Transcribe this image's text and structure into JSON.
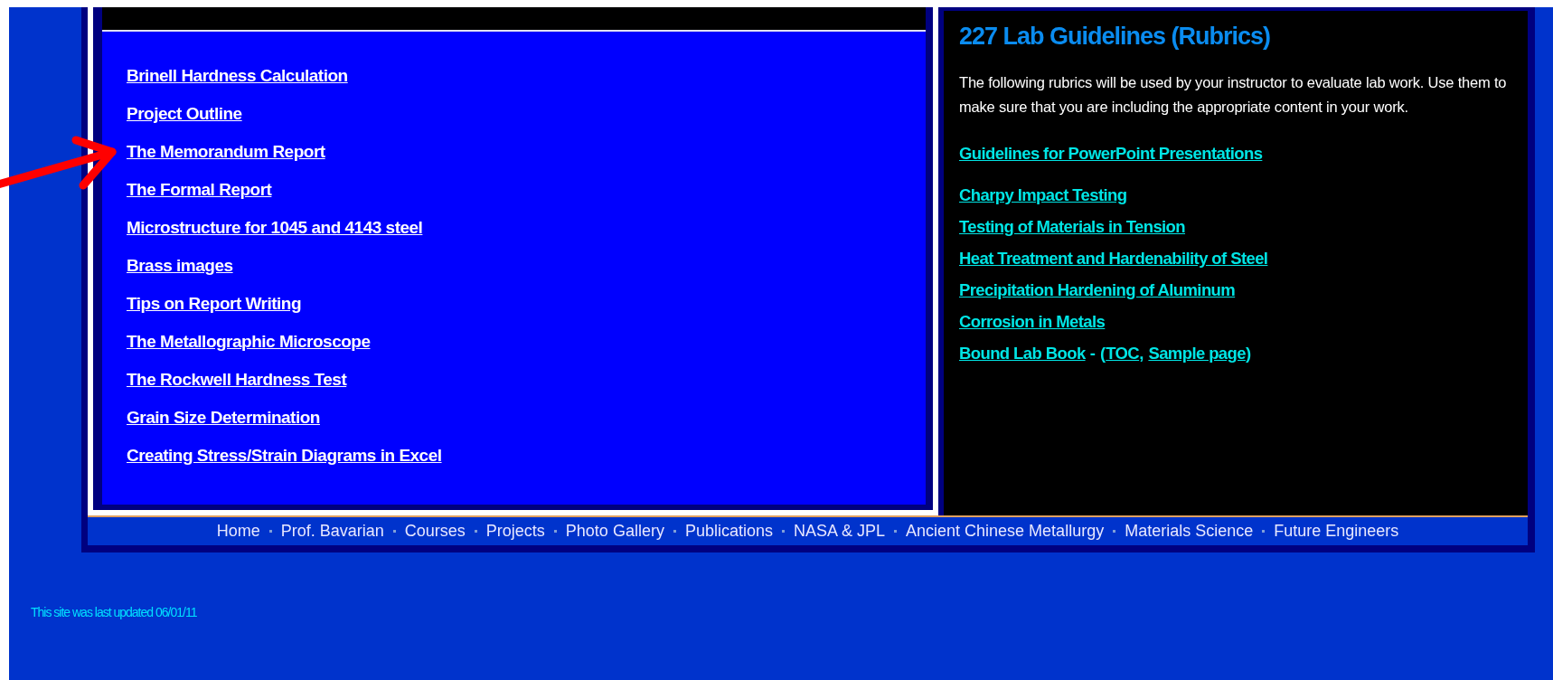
{
  "left_panel": {
    "links": [
      {
        "label": "Brinell Hardness Calculation"
      },
      {
        "label": "Project Outline"
      },
      {
        "label": "The Memorandum Report"
      },
      {
        "label": "The Formal Report"
      },
      {
        "label": "Microstructure for 1045 and 4143 steel"
      },
      {
        "label": "Brass images"
      },
      {
        "label": "Tips on Report Writing"
      },
      {
        "label": "The Metallographic Microscope"
      },
      {
        "label": "The Rockwell Hardness Test"
      },
      {
        "label": "Grain Size Determination"
      },
      {
        "label": "Creating Stress/Strain Diagrams in Excel"
      }
    ]
  },
  "right_panel": {
    "title": "227 Lab Guidelines (Rubrics)",
    "intro": "The following rubrics will be used by your instructor to evaluate lab work. Use them to make sure that you are including the appropriate content in your work.",
    "featured_link": "Guidelines for PowerPoint Presentations",
    "lines": [
      [
        {
          "kind": "link",
          "text": "Charpy Impact Testing"
        }
      ],
      [
        {
          "kind": "link",
          "text": "Testing of Materials in Tension"
        }
      ],
      [
        {
          "kind": "link",
          "text": "Heat Treatment and Hardenability of Steel"
        }
      ],
      [
        {
          "kind": "link",
          "text": "Precipitation Hardening of Aluminum"
        }
      ],
      [
        {
          "kind": "link",
          "text": "Corrosion in Metals"
        }
      ],
      [
        {
          "kind": "link",
          "text": "Bound Lab Book"
        },
        {
          "kind": "text",
          "text": " - ("
        },
        {
          "kind": "link",
          "text": "TOC"
        },
        {
          "kind": "text",
          "text": ", "
        },
        {
          "kind": "link",
          "text": "Sample page"
        },
        {
          "kind": "text",
          "text": ")"
        }
      ]
    ]
  },
  "footer_nav": [
    "Home",
    "Prof. Bavarian",
    "Courses",
    "Projects",
    "Photo Gallery",
    "Publications",
    "NASA & JPL",
    "Ancient Chinese Metallurgy",
    "Materials Science",
    "Future Engineers"
  ],
  "last_updated": "This site was last updated 06/01/11"
}
